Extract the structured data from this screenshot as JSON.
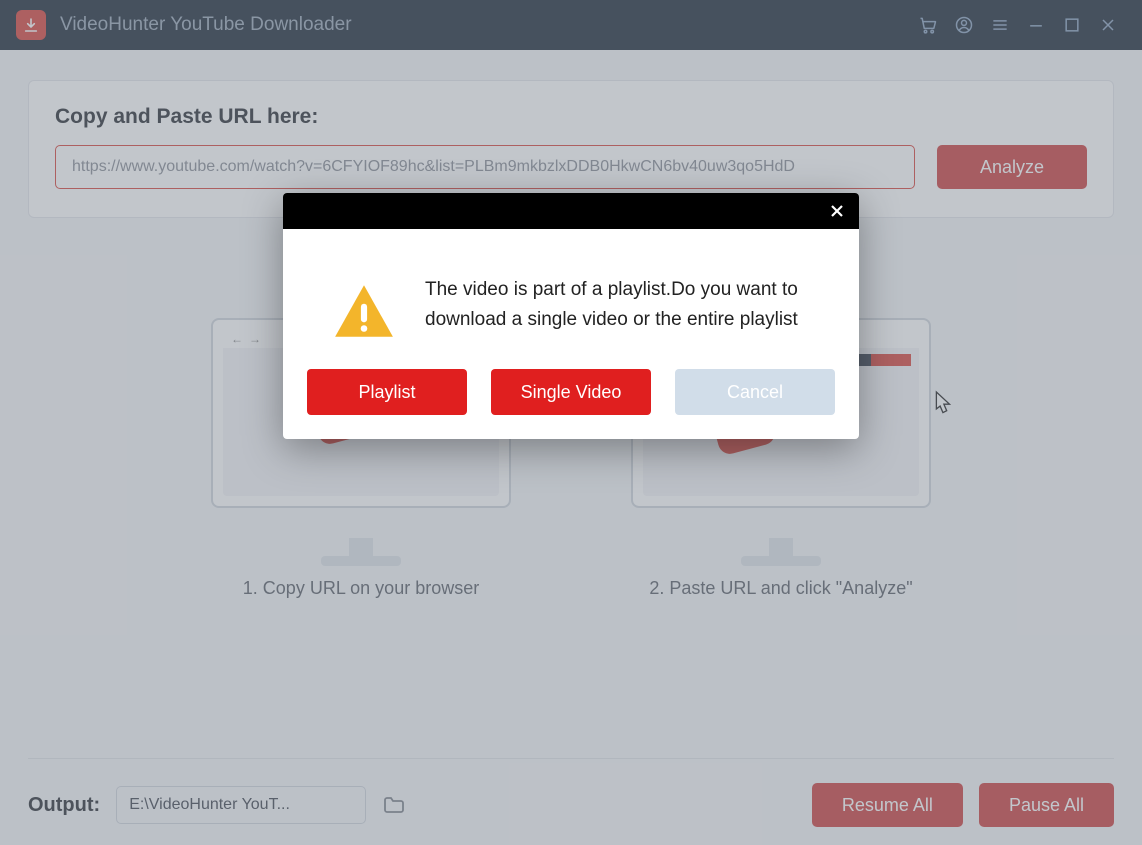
{
  "app": {
    "title": "VideoHunter YouTube Downloader"
  },
  "url_section": {
    "label": "Copy and Paste URL here:",
    "input_value": "https://www.youtube.com/watch?v=6CFYIOF89hc&list=PLBm9mkbzlxDDB0HkwCN6bv40uw3qo5HdD",
    "analyze_label": "Analyze"
  },
  "steps": {
    "step1_caption": "1. Copy URL on your browser",
    "step2_caption": "2. Paste URL and click \"Analyze\""
  },
  "footer": {
    "output_label": "Output:",
    "output_path": "E:\\VideoHunter YouT...",
    "resume_label": "Resume All",
    "pause_label": "Pause All"
  },
  "dialog": {
    "message": "The video is part of a playlist.Do you want to download a single video or the entire playlist",
    "playlist_label": "Playlist",
    "single_label": "Single Video",
    "cancel_label": "Cancel"
  }
}
